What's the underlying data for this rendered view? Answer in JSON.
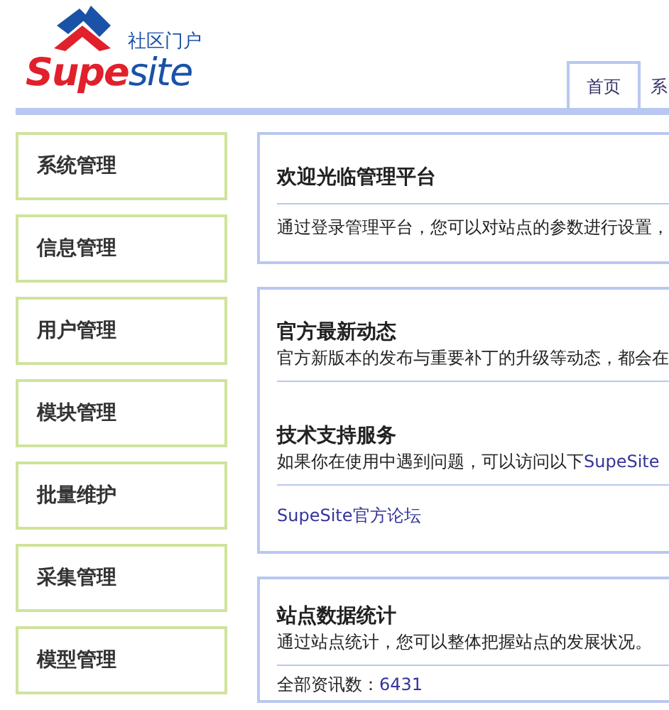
{
  "logo": {
    "tagline": "社区门户",
    "wordmark": [
      "Supe",
      "site"
    ]
  },
  "tabs": [
    {
      "label": "首页",
      "selected": true
    },
    {
      "label": "系",
      "selected": false
    }
  ],
  "sidebar": {
    "items": [
      "系统管理",
      "信息管理",
      "用户管理",
      "模块管理",
      "批量维护",
      "采集管理",
      "模型管理"
    ]
  },
  "panels": [
    {
      "sections": [
        {
          "title": "欢迎光临管理平台",
          "divider_after_title": true,
          "text": "通过登录管理平台，您可以对站点的参数进行设置，"
        }
      ]
    },
    {
      "sections": [
        {
          "title": "官方最新动态",
          "text": "官方新版本的发布与重要补丁的升级等动态，都会在"
        },
        {
          "title": "技术支持服务",
          "text": "如果你在使用中遇到问题，可以访问以下",
          "text_link": "SupeSite",
          "links": [
            "SupeSite官方论坛"
          ]
        }
      ]
    },
    {
      "sections": [
        {
          "title": "站点数据统计",
          "text": "通过站点统计，您可以整体把握站点的发展状况。",
          "stat": {
            "label": "全部资讯数：",
            "value": "6431"
          }
        }
      ]
    }
  ]
}
